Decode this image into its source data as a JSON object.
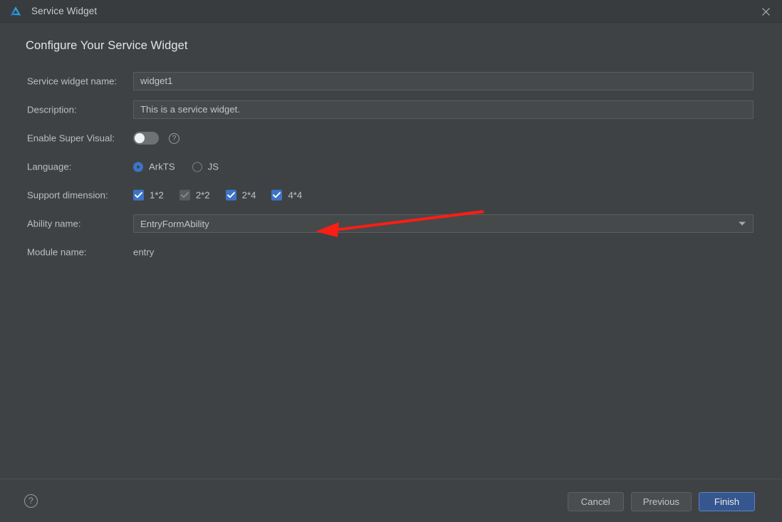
{
  "window": {
    "title": "Service Widget",
    "logo_icon": "deveco-logo-icon",
    "close_icon": "close-icon"
  },
  "colors": {
    "accent": "#3d74c9",
    "primary_button": "#36568f",
    "annotation": "#fa1e14",
    "titlebar_bg": "#393c3f",
    "content_bg": "#3f4244",
    "field_bg": "#45494a",
    "field_border": "#5a5d5f",
    "disabled_checkbox": "#595c5e"
  },
  "heading": "Configure Your Service Widget",
  "fields": {
    "widget_name": {
      "label": "Service widget name:",
      "value": "widget1",
      "placeholder": "widget1"
    },
    "description": {
      "label": "Description:",
      "value": "This is a service widget.",
      "placeholder": "This is a service widget."
    },
    "super_visual": {
      "label": "Enable Super Visual:",
      "enabled": false,
      "help_icon": "question-mark-icon",
      "help_label": "?"
    },
    "language": {
      "label": "Language:",
      "options": [
        {
          "label": "ArkTS",
          "selected": true
        },
        {
          "label": "JS",
          "selected": false
        }
      ]
    },
    "support_dimension": {
      "label": "Support dimension:",
      "options": [
        {
          "label": "1*2",
          "checked": true,
          "disabled": false
        },
        {
          "label": "2*2",
          "checked": true,
          "disabled": true
        },
        {
          "label": "2*4",
          "checked": true,
          "disabled": false
        },
        {
          "label": "4*4",
          "checked": true,
          "disabled": false
        }
      ]
    },
    "ability_name": {
      "label": "Ability name:",
      "value": "EntryFormAbility",
      "dropdown_icon": "chevron-down-icon"
    },
    "module_name": {
      "label": "Module name:",
      "value": "entry"
    }
  },
  "annotation": {
    "type": "arrow",
    "direction": "left",
    "color": "#fa1e14"
  },
  "footer": {
    "help_icon": "question-mark-icon",
    "help_label": "?",
    "buttons": [
      {
        "label": "Cancel",
        "primary": false
      },
      {
        "label": "Previous",
        "primary": false
      },
      {
        "label": "Finish",
        "primary": true
      }
    ]
  }
}
